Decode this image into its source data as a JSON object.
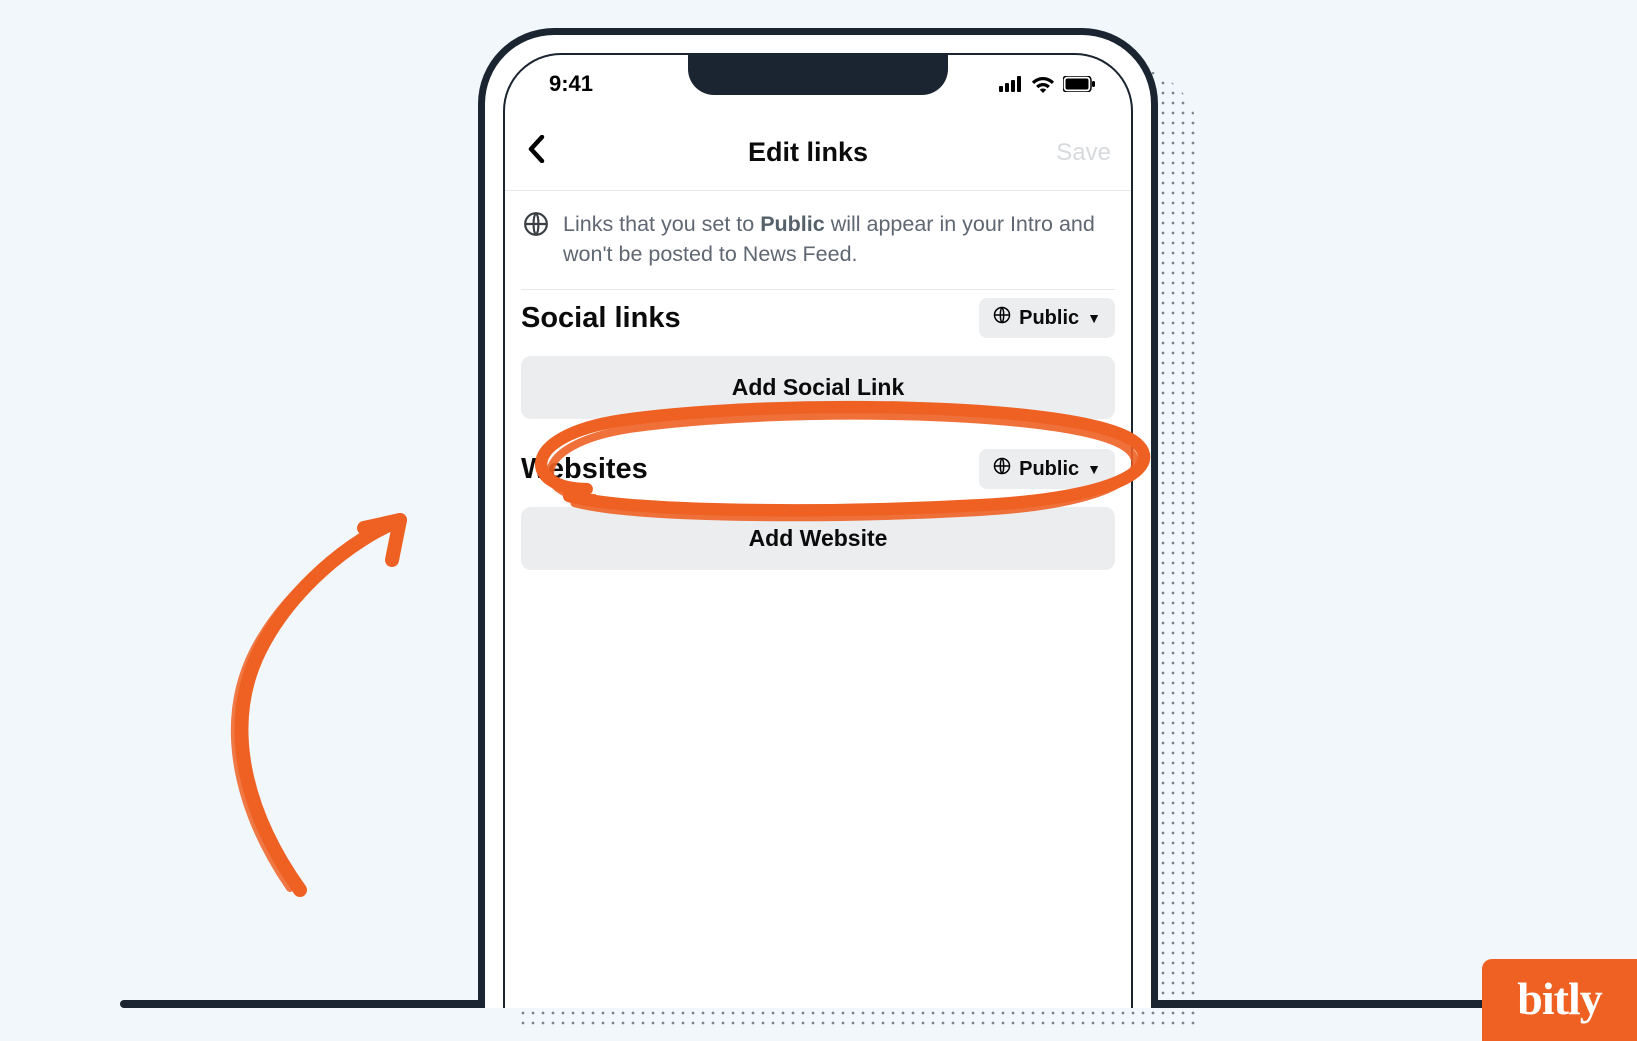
{
  "status": {
    "time": "9:41"
  },
  "header": {
    "title": "Edit links",
    "save": "Save"
  },
  "info": {
    "prefix": "Links that you set to ",
    "bold": "Public",
    "suffix": " will appear in your Intro and won't be posted to News Feed."
  },
  "sections": {
    "social": {
      "title": "Social links",
      "privacy": "Public",
      "button": "Add Social Link"
    },
    "websites": {
      "title": "Websites",
      "privacy": "Public",
      "button": "Add Website"
    }
  },
  "brand": {
    "name": "bitly"
  },
  "colors": {
    "accent": "#ee6123",
    "ink": "#1b2531",
    "bg": "#f2f7fb",
    "pill": "#ebedef"
  }
}
